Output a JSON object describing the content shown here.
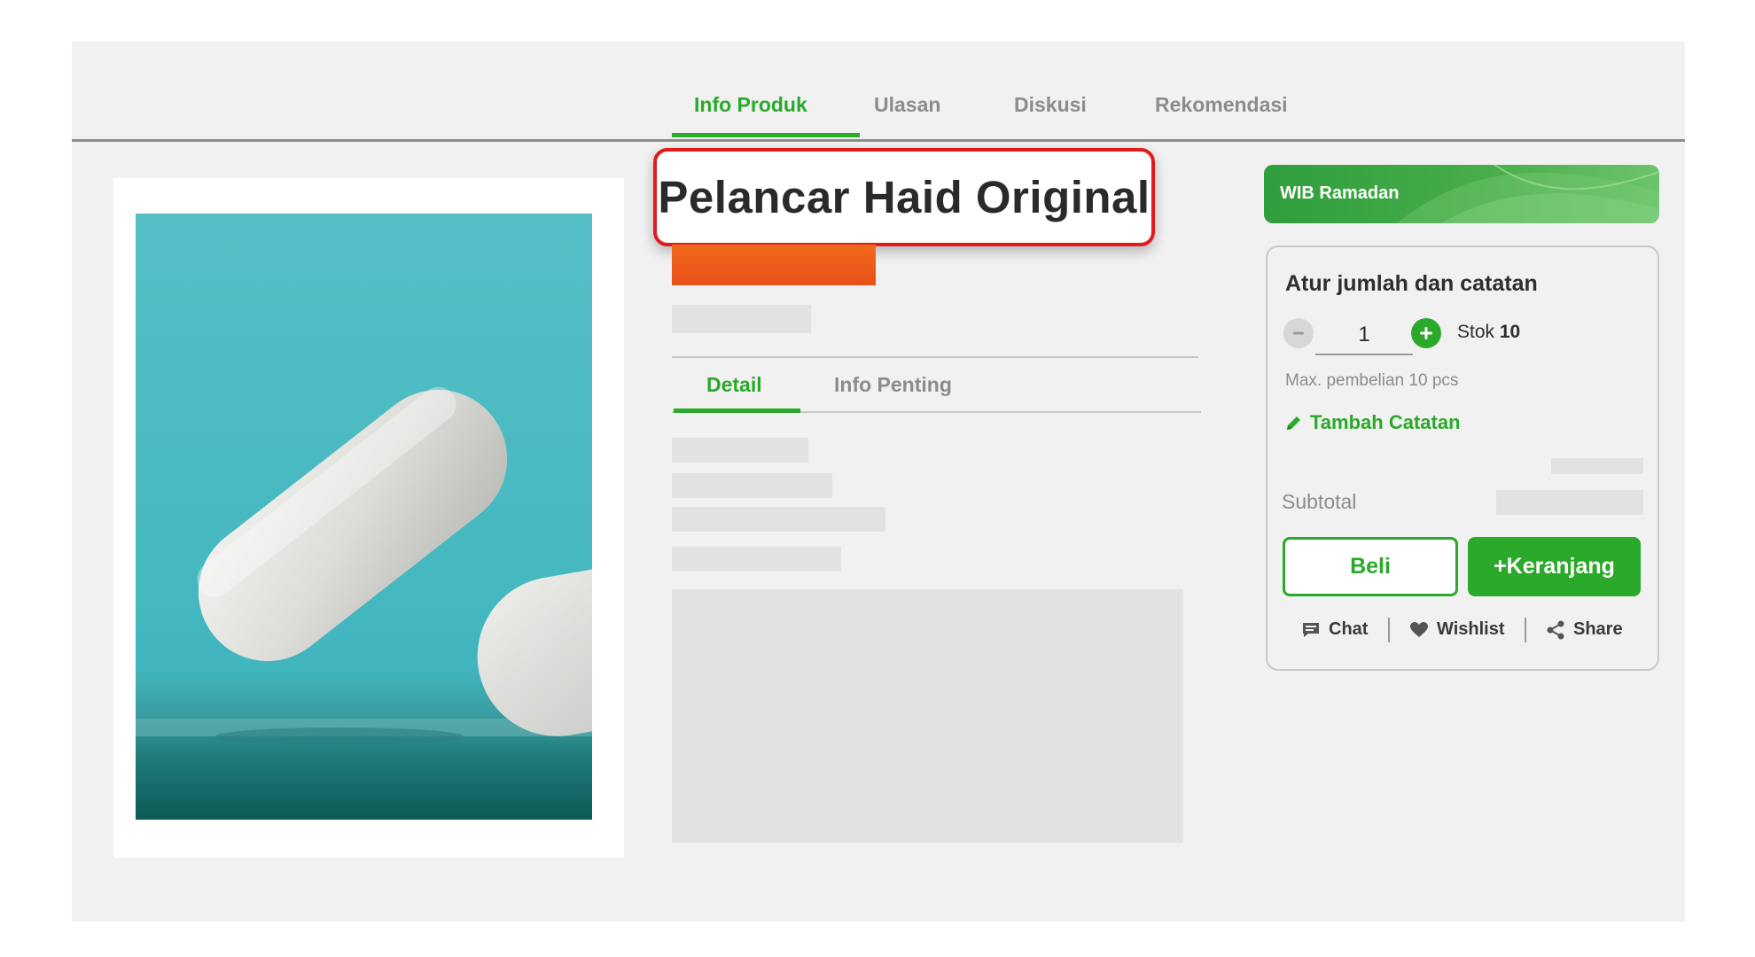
{
  "tabs": [
    {
      "label": "Info Produk",
      "active": true
    },
    {
      "label": "Ulasan",
      "active": false
    },
    {
      "label": "Diskusi",
      "active": false
    },
    {
      "label": "Rekomendasi",
      "active": false
    }
  ],
  "product": {
    "title": "Pelancar Haid Original"
  },
  "detail_tabs": [
    {
      "label": "Detail",
      "active": true
    },
    {
      "label": "Info Penting",
      "active": false
    }
  ],
  "promo": {
    "label": "WIB Ramadan"
  },
  "order": {
    "title": "Atur jumlah dan catatan",
    "quantity": "1",
    "stock_label": "Stok",
    "stock_value": "10",
    "max_purchase": "Max. pembelian 10 pcs",
    "add_note": "Tambah Catatan",
    "subtotal_label": "Subtotal",
    "buy_label": "Beli",
    "cart_label": "+Keranjang"
  },
  "actions": {
    "chat": "Chat",
    "wishlist": "Wishlist",
    "share": "Share"
  },
  "colors": {
    "accent": "#2aa92a",
    "promo_orange": "#e8501a",
    "callout_border": "#e01b1b"
  }
}
